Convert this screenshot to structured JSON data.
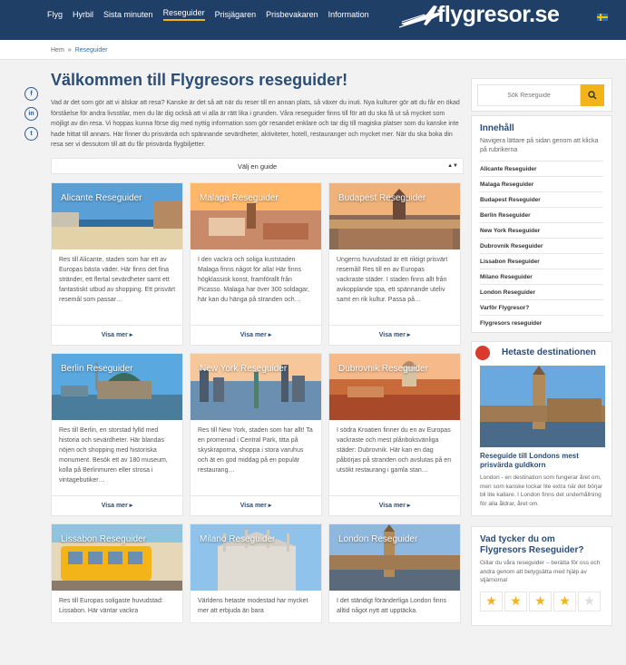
{
  "nav": {
    "items": [
      "Flyg",
      "Hyrbil",
      "Sista minuten",
      "Reseguider",
      "Prisjägaren",
      "Prisbevakaren",
      "Information"
    ],
    "active_index": 3,
    "logo": "flygresor.se"
  },
  "breadcrumb": {
    "home": "Hem",
    "separator": "»",
    "current": "Reseguider"
  },
  "page": {
    "title": "Välkommen till Flygresors reseguider!",
    "intro": "Vad är det som gör att vi älskar att resa? Kanske är det så att när du reser till en annan plats, så växer du inuti. Nya kulturer gör att du får en ökad förståelse för andra livsstilar, men du lär dig också att vi alla är rätt lika i grunden. Våra reseguider finns till för att du ska få ut så mycket som möjligt av din resa. Vi hoppas kunna förse dig med nyttig information som gör resandet enklare och tar dig till magiska platser som du kanske inte hade hittat till annars. Här finner du prisvärda och spännande sevärdheter, aktiviteter, hotell, restauranger och mycket mer. När du ska boka din resa ser vi dessutom till att du får prisvärda flygbiljetter.",
    "guide_select": "Välj en guide"
  },
  "cards": [
    {
      "name": "Alicante",
      "title": "Alicante Reseguider",
      "text": "Res till Alicante, staden som har ett av Europas bästa väder. Här finns det fina stränder, ett flertal sevärdheter samt ett fantastiskt utbud av shopping. Ett prisvärt resemål som passar…",
      "more": "Visa mer"
    },
    {
      "name": "Malaga",
      "title": "Malaga Reseguider",
      "text": "I den vackra och soliga kuststaden Malaga finns något för alla! Här finns högklassisk konst, framförallt från Picasso. Malaga har över 300 soldagar, här kan du hänga på stranden och…",
      "more": "Visa mer"
    },
    {
      "name": "Budapest",
      "title": "Budapest Reseguider",
      "text": "Ungerns huvudstad är ett riktigt prisvärt resemål! Res till en av Europas vackraste städer. I staden finns allt från avkopplande spa, ett spännande uteliv samt en rik kultur. Passa på…",
      "more": "Visa mer"
    },
    {
      "name": "Berlin",
      "title": "Berlin Reseguider",
      "text": "Res till Berlin, en storstad fylld med historia och sevärdheter. Här blandas nöjen och shopping med historiska monument. Besök ett av 180 museum, kolla på Berlinmuren eller strosa i vintagebutiker…",
      "more": "Visa mer"
    },
    {
      "name": "New York",
      "title": "New York Reseguider",
      "text": "Res till New York, staden som har allt! Ta en promenad i Central Park, titta på skyskraporna, shoppa i stora varuhus och ät en god middag på en populär restaurang…",
      "more": "Visa mer"
    },
    {
      "name": "Dubrovnik",
      "title": "Dubrovnik Reseguider",
      "text": "I södra Kroatien finner du en av Europas vackraste och mest plånboksvänliga städer: Dubrovnik. Här kan en dag påbörjas på stranden och avslutas på en utsökt restaurang i gamla stan…",
      "more": "Visa mer"
    },
    {
      "name": "Lissabon",
      "title": "Lissabon Reseguider",
      "text": "Res till Europas soligaste huvudstad: Lissabon. Här väntar vackra",
      "more": ""
    },
    {
      "name": "Milano",
      "title": "Milano Reseguider",
      "text": "Världens hetaste modestad har mycket mer att erbjuda än bara",
      "more": ""
    },
    {
      "name": "London",
      "title": "London Reseguider",
      "text": "I det ständigt föränderliga London finns alltid något nytt att upptäcka.",
      "more": ""
    }
  ],
  "sidebar": {
    "search_placeholder": "Sök Reseguide",
    "toc": {
      "title": "Innehåll",
      "description": "Navigera lättare på sidan genom att klicka på rubrikerna",
      "items": [
        "Alicante Reseguider",
        "Malaga Reseguider",
        "Budapest Reseguider",
        "Berlin Reseguider",
        "New York Reseguider",
        "Dubrovnik Reseguider",
        "Lissabon Reseguider",
        "Milano Reseguider",
        "London Reseguider",
        "Varför Flygresor?",
        "Flygresors reseguider"
      ]
    },
    "hot": {
      "title": "Hetaste destinationen",
      "link": "Reseguide till Londons mest prisvärda guldkorn",
      "text": "London - en destination som fungerar året om, men som kanske lockar lite extra när det börjar bli lite kallare. I London finns det underhållning för alla åldrar, året om."
    },
    "rate": {
      "title": "Vad tycker du om Flygresors Reseguider?",
      "text": "Gillar du våra reseguider – berätta för oss och andra genom att betygsätta med hjälp av stjärnorna!",
      "stars_filled": 4,
      "stars_total": 5
    }
  },
  "colors": {
    "header": "#1f3f66",
    "accent": "#f2b418",
    "title": "#2b4d76",
    "hot": "#d93a2b"
  }
}
